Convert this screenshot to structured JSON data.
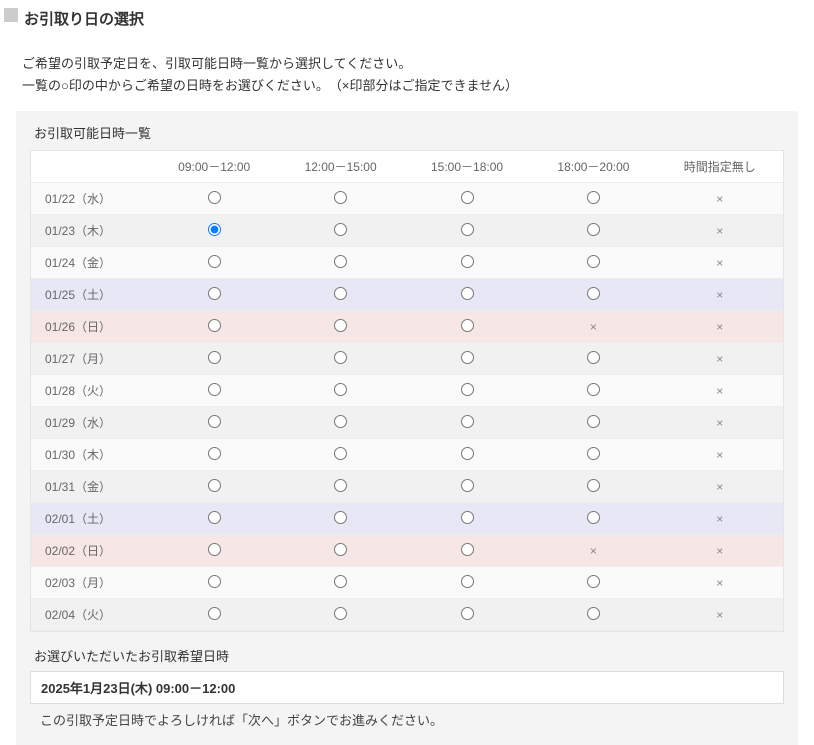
{
  "page_title": "お引取り日の選択",
  "description_line1": "ご希望の引取予定日を、引取可能日時一覧から選択してください。",
  "description_line2": "一覧の○印の中からご希望の日時をお選びください。　（×印部分はご指定できません）",
  "panel_title": "お引取可能日時一覧",
  "time_slots": [
    "09:00－12:00",
    "12:00－15:00",
    "15:00－18:00",
    "18:00－20:00",
    "時間指定無し"
  ],
  "x_mark": "×",
  "rows": [
    {
      "label": "01/22（水）",
      "type": "even",
      "cells": [
        "radio",
        "radio",
        "radio",
        "radio",
        "x"
      ]
    },
    {
      "label": "01/23（木）",
      "type": "odd",
      "cells": [
        "radio",
        "radio",
        "radio",
        "radio",
        "x"
      ],
      "selected_index": 0
    },
    {
      "label": "01/24（金）",
      "type": "even",
      "cells": [
        "radio",
        "radio",
        "radio",
        "radio",
        "x"
      ]
    },
    {
      "label": "01/25（土）",
      "type": "sat",
      "cells": [
        "radio",
        "radio",
        "radio",
        "radio",
        "x"
      ]
    },
    {
      "label": "01/26（日）",
      "type": "sun",
      "cells": [
        "radio",
        "radio",
        "radio",
        "x",
        "x"
      ]
    },
    {
      "label": "01/27（月）",
      "type": "odd",
      "cells": [
        "radio",
        "radio",
        "radio",
        "radio",
        "x"
      ]
    },
    {
      "label": "01/28（火）",
      "type": "even",
      "cells": [
        "radio",
        "radio",
        "radio",
        "radio",
        "x"
      ]
    },
    {
      "label": "01/29（水）",
      "type": "odd",
      "cells": [
        "radio",
        "radio",
        "radio",
        "radio",
        "x"
      ]
    },
    {
      "label": "01/30（木）",
      "type": "even",
      "cells": [
        "radio",
        "radio",
        "radio",
        "radio",
        "x"
      ]
    },
    {
      "label": "01/31（金）",
      "type": "odd",
      "cells": [
        "radio",
        "radio",
        "radio",
        "radio",
        "x"
      ]
    },
    {
      "label": "02/01（土）",
      "type": "sat",
      "cells": [
        "radio",
        "radio",
        "radio",
        "radio",
        "x"
      ]
    },
    {
      "label": "02/02（日）",
      "type": "sun",
      "cells": [
        "radio",
        "radio",
        "radio",
        "x",
        "x"
      ]
    },
    {
      "label": "02/03（月）",
      "type": "even",
      "cells": [
        "radio",
        "radio",
        "radio",
        "radio",
        "x"
      ]
    },
    {
      "label": "02/04（火）",
      "type": "odd",
      "cells": [
        "radio",
        "radio",
        "radio",
        "radio",
        "x"
      ]
    }
  ],
  "selected_label": "お選びいただいたお引取希望日時",
  "selected_value": "2025年1月23日(木)  09:00－12:00",
  "selected_note": "この引取予定日時でよろしければ「次へ」ボタンでお進みください。"
}
